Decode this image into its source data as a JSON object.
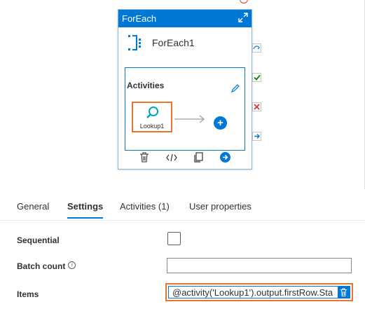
{
  "pipeline_node": {
    "header_title": "ForEach",
    "activity_name": "ForEach1",
    "activities_label": "Activities",
    "inner_activity": {
      "label": "Lookup1"
    }
  },
  "tabs": [
    {
      "label": "General",
      "active": false
    },
    {
      "label": "Settings",
      "active": true
    },
    {
      "label": "Activities (1)",
      "active": false
    },
    {
      "label": "User properties",
      "active": false
    }
  ],
  "settings": {
    "sequential_label": "Sequential",
    "sequential_checked": false,
    "batch_count_label": "Batch count",
    "batch_count_value": "",
    "items_label": "Items",
    "items_value": "@activity('Lookup1').output.firstRow.Sta"
  },
  "colors": {
    "accent": "#0078d4",
    "highlight": "#e8742e",
    "success": "#107c10",
    "failure": "#d13438"
  },
  "icons": [
    "expand-icon",
    "foreach-icon",
    "edit-icon",
    "search-icon",
    "arrow-icon",
    "add-icon",
    "delete-icon",
    "code-icon",
    "copy-icon",
    "go-icon",
    "skipped-icon",
    "success-icon",
    "failure-icon",
    "completion-icon",
    "info-icon"
  ]
}
